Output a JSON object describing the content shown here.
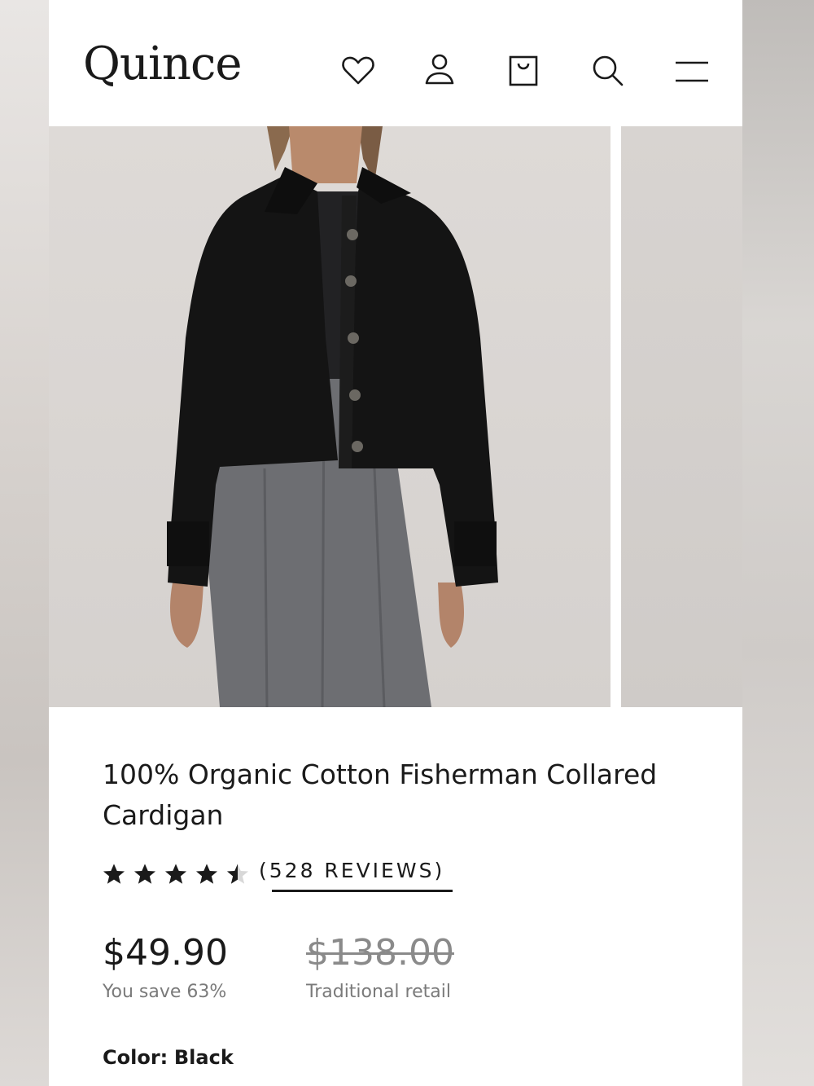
{
  "header": {
    "logo": "Quince",
    "icons": [
      "heart-icon",
      "account-icon",
      "bag-icon",
      "search-icon",
      "menu-icon"
    ]
  },
  "product": {
    "title": "100% Organic Cotton Fisherman Collared Cardigan",
    "rating": 4.5,
    "rating_max": 5,
    "reviews_label": "(528 REVIEWS)",
    "price": "$49.90",
    "savings": "You save 63%",
    "original_price": "$138.00",
    "original_price_label": "Traditional retail",
    "color_label": "Color:",
    "color_value": "Black"
  },
  "colors": {
    "text": "#1a1a1a",
    "muted": "#7a7a7a",
    "strikethrough": "#8a8a8a",
    "garment": "#141414",
    "trousers": "#6d6e72"
  }
}
